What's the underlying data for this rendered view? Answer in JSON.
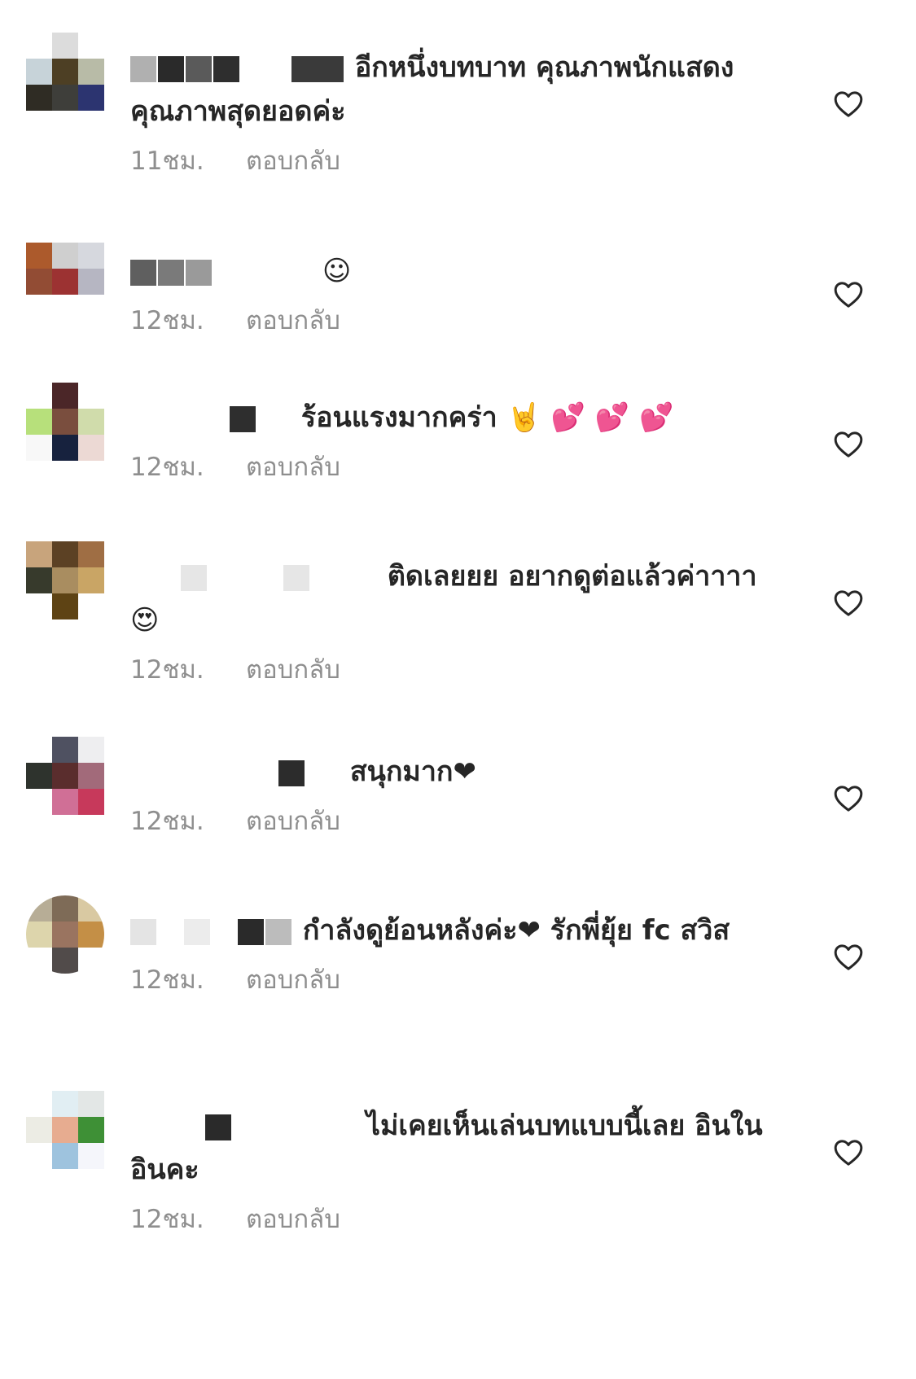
{
  "comments": [
    {
      "avatar": [
        "#ffffff",
        "#dcdcdc",
        "#ffffff",
        "#c7d3d9",
        "#4d3f24",
        "#b8bba7",
        "#2f2c24",
        "#3e3e3a",
        "#2c3470"
      ],
      "masks": [
        [
          "#b0b0b0",
          32
        ],
        [
          "#2a2a2a",
          32
        ],
        [
          "#5a5a5a",
          32
        ],
        [
          "#2e2e2e",
          32
        ],
        [
          "#ffffff",
          60
        ],
        [
          "#3a3a3a",
          64
        ]
      ],
      "text": "อีกหนึ่งบทบาท คุณภาพนักแสดงคุณภาพสุดยอดค่ะ",
      "time": "11ชม.",
      "reply": "ตอบกลับ"
    },
    {
      "avatar": [
        "#ac5a2c",
        "#cfcfcf",
        "#d6d8de",
        "#924c34",
        "#9c3232",
        "#b6b6c2",
        "#ffffff",
        "#ffffff",
        "#ffffff"
      ],
      "masks": [
        [
          "#5f5f5f",
          32
        ],
        [
          "#7a7a7a",
          32
        ],
        [
          "#9a9a9a",
          32
        ],
        [
          "#ffffff",
          120
        ]
      ],
      "text": "☺",
      "time": "12ชม.",
      "reply": "ตอบกลับ"
    },
    {
      "avatar": [
        "#ffffff",
        "#4b2628",
        "#ffffff",
        "#b7e07b",
        "#7a4e3e",
        "#d0dcab",
        "#f8f8f8",
        "#17223e",
        "#ecd9d4"
      ],
      "masks": [
        [
          "#ffffff",
          120
        ],
        [
          "#2e2e2e",
          32
        ],
        [
          "#ffffff",
          40
        ]
      ],
      "text": "ร้อนแรงมากคร่า 🤘 💕 💕 💕",
      "time": "12ชม.",
      "reply": "ตอบกลับ"
    },
    {
      "avatar": [
        "#c8a47c",
        "#5c4124",
        "#9f6e44",
        "#373a2c",
        "#a98d60",
        "#c9a565",
        "#ffffff",
        "#5e4314",
        "#ffffff"
      ],
      "masks": [
        [
          "#ffffff",
          60
        ],
        [
          "#e6e6e6",
          32
        ],
        [
          "#ffffff",
          90
        ],
        [
          "#e6e6e6",
          32
        ],
        [
          "#ffffff",
          80
        ]
      ],
      "text": "ติดเลยยย อยากดูต่อแล้วค่าาาา😍",
      "time": "12ชม.",
      "reply": "ตอบกลับ"
    },
    {
      "avatar": [
        "#ffffff",
        "#4f5161",
        "#eeeef0",
        "#2e332d",
        "#5a2d2d",
        "#a26a7a",
        "#ffffff",
        "#d06f96",
        "#c7395b"
      ],
      "masks": [
        [
          "#ffffff",
          180
        ],
        [
          "#2c2c2c",
          32
        ],
        [
          "#ffffff",
          40
        ]
      ],
      "text": "สนุกมาก❤",
      "time": "12ชม.",
      "reply": "ตอบกลับ"
    },
    {
      "avatar": [
        "#b7ad96",
        "#7e6b57",
        "#d9c9a2",
        "#ddd5ac",
        "#9a7460",
        "#c48f46",
        "#ffffff",
        "#514b4a",
        "#ffffff"
      ],
      "masks": [
        [
          "#e4e4e4",
          32
        ],
        [
          "#ffffff",
          30
        ],
        [
          "#ececec",
          32
        ],
        [
          "#ffffff",
          30
        ],
        [
          "#2a2a2a",
          32
        ],
        [
          "#bcbcbc",
          32
        ]
      ],
      "text": "กำลังดูย้อนหลังค่ะ❤ รักพี่ยุ้ย fc สวิส",
      "time": "12ชม.",
      "reply": "ตอบกลับ"
    },
    {
      "avatar": [
        "#ffffff",
        "#e1eef3",
        "#e3e7e6",
        "#ecece4",
        "#e7ac90",
        "#3e9036",
        "#ffffff",
        "#9ec3de",
        "#f5f6fb"
      ],
      "masks": [
        [
          "#ffffff",
          90
        ],
        [
          "#2a2a2a",
          32
        ],
        [
          "#ffffff",
          150
        ]
      ],
      "text": "ไม่เคยเห็นเล่นบทแบบนี้เลย อินในอินคะ",
      "time": "12ชม.",
      "reply": "ตอบกลับ"
    }
  ],
  "colors": {
    "text": "#262626",
    "meta": "#8e8e8e",
    "heart_stroke": "#262626"
  },
  "icons": {
    "like": "heart-outline-icon"
  }
}
